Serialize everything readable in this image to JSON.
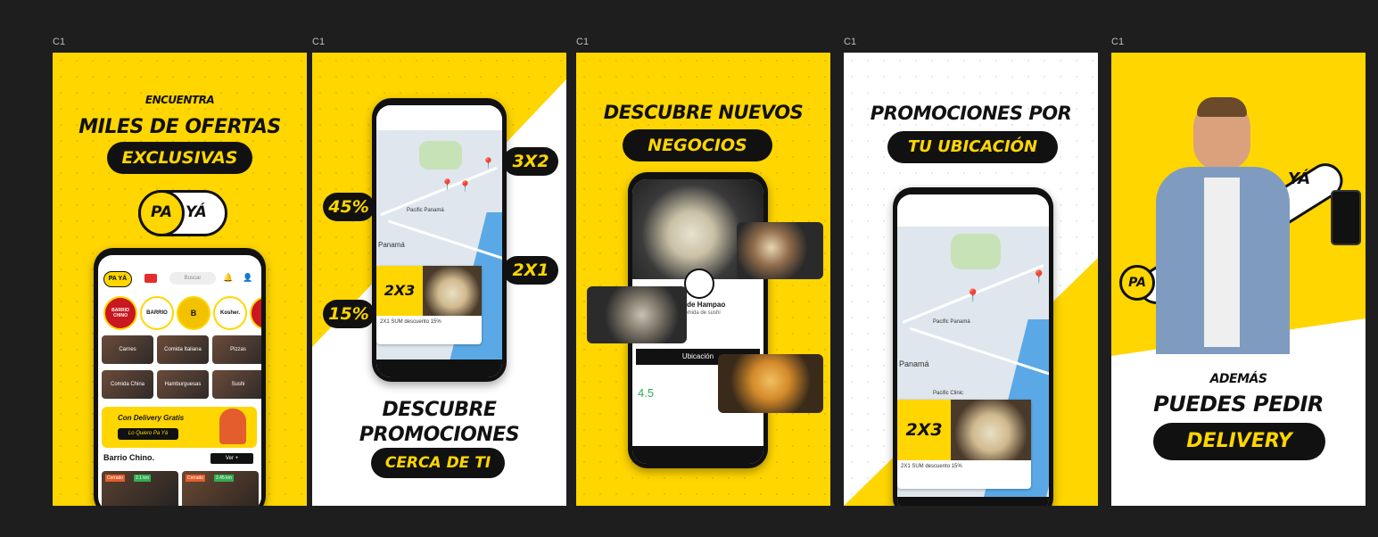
{
  "frames": [
    {
      "label": "C1"
    },
    {
      "label": "C1"
    },
    {
      "label": "C1"
    },
    {
      "label": "C1"
    },
    {
      "label": "C1"
    }
  ],
  "colors": {
    "brand_yellow": "#ffd600",
    "dark": "#111111",
    "canvas": "#1e1e1e"
  },
  "logo": {
    "left": "PA",
    "right": "YÁ"
  },
  "slide1": {
    "kicker": "ENCUENTRA",
    "headline": "MILES DE OFERTAS",
    "pill": "EXCLUSIVAS",
    "app": {
      "search_placeholder": "Buscar",
      "stores": [
        "BARRIO CHINO",
        "BARRIO",
        "B",
        "Kosher."
      ],
      "categories": [
        "Carnes",
        "Comida Italiana",
        "Pizzas",
        "Comida China",
        "Hamburguesas",
        "Sushi"
      ],
      "banner_title": "Con Delivery Gratis",
      "banner_button": "Lo Quiero Pa Yá",
      "section_title": "Barrio Chino.",
      "section_button": "Ver +",
      "card_tags": [
        "Cerrado",
        "2.1 km",
        "Cerrado",
        "2.45 km"
      ]
    }
  },
  "slide2": {
    "badges": [
      "3X2",
      "45%",
      "2X1",
      "15%"
    ],
    "line1": "DESCUBRE",
    "line2": "PROMOCIONES",
    "pill": "CERCA DE TI",
    "map_label_1": "Panamá",
    "map_label_2": "Pacific Panamá",
    "promo_text": "2X3",
    "promo_caption": "2X1 SUM descuento 15%"
  },
  "slide3": {
    "headline": "DESCUBRE NUEVOS",
    "pill": "NEGOCIOS",
    "store_name": "o de Hampao",
    "store_sub": "Comida de sushi",
    "rating": "4.5",
    "section": "Ubicación"
  },
  "slide4": {
    "headline": "PROMOCIONES POR",
    "pill": "TU UBICACIÓN",
    "map_label_1": "Panamá",
    "map_label_2": "Pacific Panamá",
    "map_label_3": "Pacific Clinic",
    "promo_text": "2X3",
    "promo_caption": "2X1 SUM descuento 15%"
  },
  "slide5": {
    "kicker": "ADEMÁS",
    "headline": "PUEDES PEDIR",
    "pill": "DELIVERY"
  }
}
